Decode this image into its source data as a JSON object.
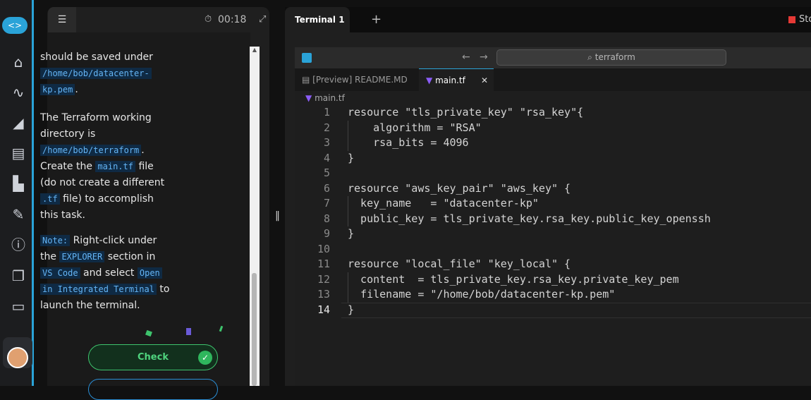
{
  "lesson": {
    "timer": "00:18",
    "para1_line1": "should be saved under",
    "para1_code": "/home/bob/datacenter-kp.pem",
    "para1_code_l1": "/home/bob/datacenter-",
    "para1_code_l2": "kp.pem",
    "para1_end": ".",
    "para2_l1": "The Terraform working",
    "para2_l2": "directory is",
    "para2_code": "/home/bob/terraform",
    "para2_after": ".",
    "para2_l4a": "Create the",
    "para2_l4code": "main.tf",
    "para2_l4b": "file",
    "para2_l5": "(do not create a different",
    "para2_l6code": ".tf",
    "para2_l6b": "file) to accomplish",
    "para2_l7": "this task.",
    "note_label": "Note:",
    "note_l1b": "Right-click under",
    "note_l2a": "the",
    "note_l2code": "EXPLORER",
    "note_l2b": "section in",
    "note_l3code": "VS Code",
    "note_l3b": "and select",
    "note_l3code2": "Open",
    "note_l4code": "in Integrated Terminal",
    "note_l4b": "to",
    "note_l5": "launch the terminal.",
    "check_label": "Check"
  },
  "terminal": {
    "tab_label": "Terminal 1",
    "add_tab": "+",
    "stop_label": "Sto"
  },
  "vscode": {
    "search": "terraform",
    "tabs": [
      {
        "label": "[Preview] README.MD"
      },
      {
        "label": "main.tf"
      }
    ],
    "breadcrumb": "main.tf",
    "lines": [
      "resource \"tls_private_key\" \"rsa_key\"{",
      "    algorithm = \"RSA\"",
      "    rsa_bits = 4096",
      "}",
      "",
      "resource \"aws_key_pair\" \"aws_key\" {",
      "  key_name   = \"datacenter-kp\"",
      "  public_key = tls_private_key.rsa_key.public_key_openssh",
      "}",
      "",
      "resource \"local_file\" \"key_local\" {",
      "  content  = tls_private_key.rsa_key.private_key_pem",
      "  filename = \"/home/bob/datacenter-kp.pem\"",
      "}"
    ],
    "line_numbers": [
      "1",
      "2",
      "3",
      "4",
      "5",
      "6",
      "7",
      "8",
      "9",
      "10",
      "11",
      "12",
      "13",
      "14"
    ]
  },
  "colors": {
    "accent": "#2aa3d8",
    "check": "#3ec46d"
  }
}
